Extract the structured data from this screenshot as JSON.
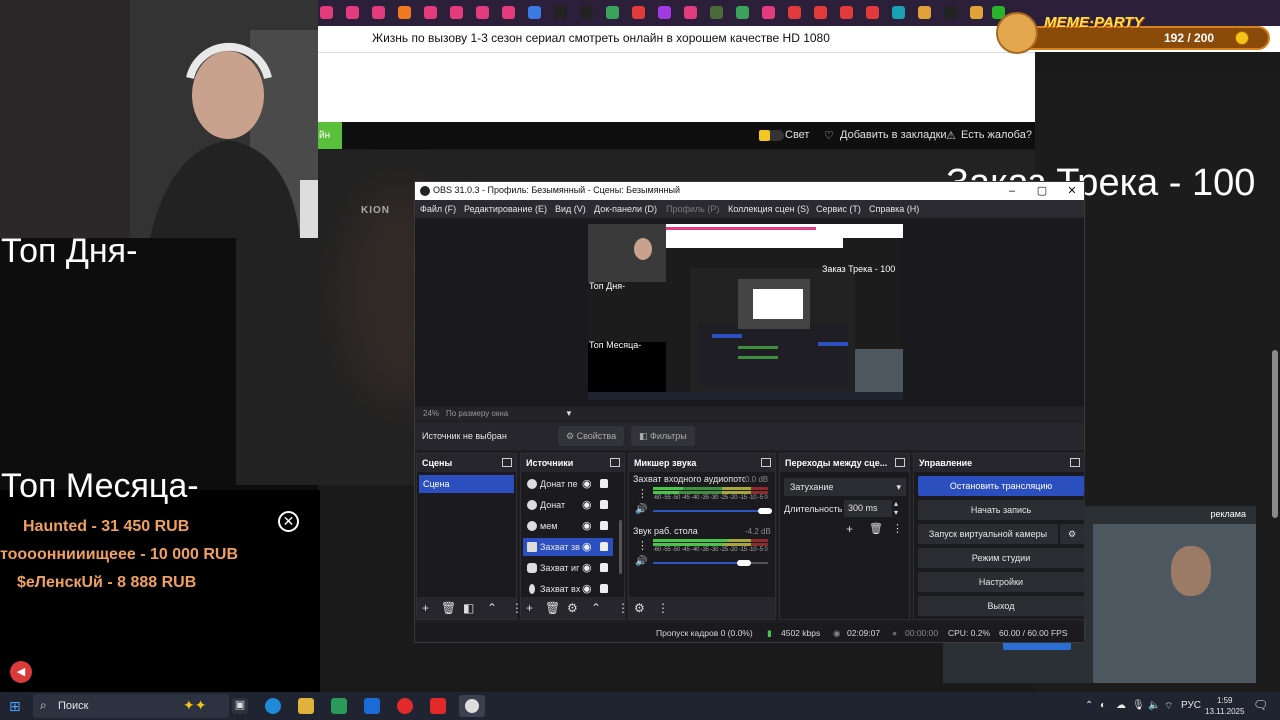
{
  "browser": {
    "page_title": "Жизнь по вызову 1-3 сезон сериал смотреть онлайн в хорошем качестве HD 1080",
    "site_nav": {
      "green_btn": "йн",
      "light": "Свет",
      "bookmark": "Добавить в закладки",
      "complaint": "Есть жалоба?"
    },
    "video_logo": "KION"
  },
  "overlay": {
    "meme_logo": "MEME·PARTY",
    "meme_count": "192 / 200",
    "top_day": "Топ Дня-",
    "top_month": "Топ Месяца-",
    "order_track": "Заказ Трека - 100",
    "donations": [
      "Haunted - 31 450 RUB",
      "тооооннииищеее - 10 000 RUB",
      "$еЛенскUй - 8 888 RUB"
    ],
    "ad_label": "реклама"
  },
  "obs": {
    "title": "OBS 31.0.3 - Профиль: Безымянный - Сцены: Безымянный",
    "menu": [
      "Файл (F)",
      "Редактирование (E)",
      "Вид (V)",
      "Док-панели (D)",
      "Профиль (P)",
      "Коллекция сцен (S)",
      "Сервис (T)",
      "Справка (H)"
    ],
    "preview": {
      "mini_top_day": "Топ Дня-",
      "mini_top_month": "Топ Месяца-",
      "mini_order": "Заказ Трека - 100"
    },
    "zoom": "24%",
    "zoom_mode": "По размеру окна",
    "no_source": "Источник не выбран",
    "properties": "Свойства",
    "filters": "Фильтры",
    "docks": {
      "scenes": "Сцены",
      "sources": "Источники",
      "mixer": "Микшер звука",
      "transitions": "Переходы между сце...",
      "controls": "Управление"
    },
    "scenes": [
      "Сцена"
    ],
    "sources": [
      "Донат пе",
      "Донат",
      "мем",
      "Захват зв",
      "Захват иг",
      "Захват вх"
    ],
    "mixer": [
      {
        "name": "Захват входного аудиопотока",
        "db": "0.0 dB"
      },
      {
        "name": "Звук раб. стола",
        "db": "-4.2 dB"
      }
    ],
    "meter_ticks": "-60 -55 -50 -45 -40 -35 -30 -25 -20 -15 -10 -5 0",
    "transition": "Затухание",
    "duration_label": "Длительность",
    "duration": "300 ms",
    "controls": [
      "Остановить трансляцию",
      "Начать запись",
      "Запуск виртуальной камеры",
      "Режим студии",
      "Настройки",
      "Выход"
    ],
    "status": {
      "dropped": "Пропуск кадров 0 (0.0%)",
      "bitrate": "4502 kbps",
      "stream_time": "02:09:07",
      "rec_time": "00:00:00",
      "cpu": "CPU: 0.2%",
      "fps": "60.00 / 60.00 FPS"
    }
  },
  "taskbar": {
    "search": "Поиск",
    "lang": "РУС",
    "time": "1:59",
    "date": "13.11.2025"
  },
  "colors": {
    "accent": "#2c4fbf",
    "meme_orange": "#d8831a",
    "donation_text": "#f0a060"
  }
}
